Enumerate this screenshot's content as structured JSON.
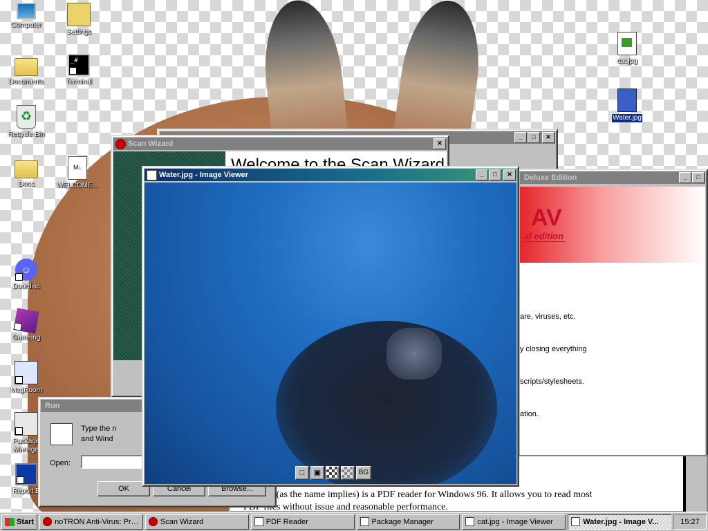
{
  "desktop": {
    "icons_left": [
      {
        "label": "Computer",
        "icon": "computer-icon"
      },
      {
        "label": "Settings",
        "icon": "settings-icon"
      },
      {
        "label": "Documents",
        "icon": "folder-icon"
      },
      {
        "label": "Terminal",
        "icon": "terminal-icon"
      },
      {
        "label": "Recycle Bin",
        "icon": "recycle-bin-icon"
      },
      {
        "label": "Docs",
        "icon": "folder-icon"
      },
      {
        "label": "WELCOME...",
        "icon": "markdown-file-icon"
      },
      {
        "label": "Doordisc",
        "icon": "discord-icon"
      },
      {
        "label": "Gameing",
        "icon": "cube-icon"
      },
      {
        "label": "MsgRoom",
        "icon": "chat-icon"
      },
      {
        "label": "Package Manage",
        "icon": "package-icon"
      },
      {
        "label": "Report B",
        "icon": "report-icon"
      }
    ],
    "icons_right": [
      {
        "label": "cat.jpg",
        "icon": "image-file-icon"
      },
      {
        "label": "Water.jpg",
        "icon": "image-file-icon",
        "selected": true
      }
    ],
    "terminal_glyph": "_#"
  },
  "windows": {
    "back_window": {
      "title": ""
    },
    "antivirus": {
      "title": "Deluxe Edition",
      "logo": "AV",
      "logo_sub": "al edition",
      "lines": [
        "are, viruses, etc.",
        "y closing everything",
        "scripts/stylesheets.",
        "ation."
      ]
    },
    "pdf_reader": {
      "body_line1": "ader (as the name implies) is a PDF reader for Windows 96. It allows you to read most",
      "body_line2": "PDF files without issue and reasonable performance."
    },
    "scan_wizard": {
      "title": "Scan Wizard",
      "heading": "Welcome to the Scan Wizard"
    },
    "run": {
      "title": "Run",
      "desc_line1": "Type the n",
      "desc_line2": "and Wind",
      "open_label": "Open:",
      "ok": "OK",
      "cancel": "Cancel",
      "browse": "Browse..."
    },
    "image_viewer": {
      "title": "Water.jpg - Image Viewer",
      "tool_bg": "BG"
    }
  },
  "taskbar": {
    "start": "Start",
    "tasks": [
      {
        "label": "noTRON Anti-Virus: Prof...",
        "active": false
      },
      {
        "label": "Scan Wizard",
        "active": false
      },
      {
        "label": "PDF Reader",
        "active": false
      },
      {
        "label": "Package Manager",
        "active": false
      },
      {
        "label": "cat.jpg - Image Viewer",
        "active": false
      },
      {
        "label": "Water.jpg - Image V...",
        "active": true
      }
    ],
    "clock": "15:27"
  },
  "colors": {
    "titlebar_active": "#0c2f6e",
    "titlebar_inactive": "#808080",
    "av_red": "#c8102e",
    "water": "#1e6ab8"
  }
}
